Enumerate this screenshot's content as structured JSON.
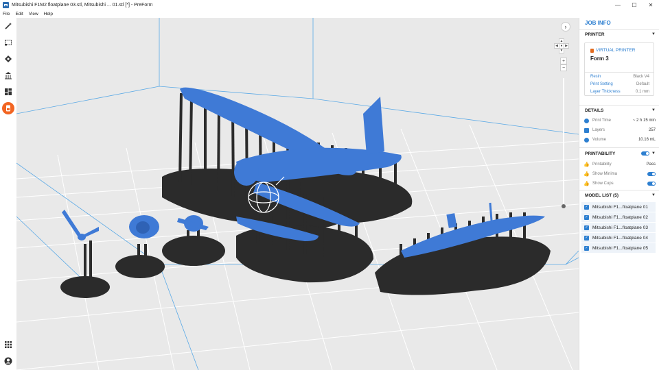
{
  "window": {
    "title": "Mitsubishi F1M2 floatplane 03.stl, Mitsubishi ... 01.stl [*] - PreForm",
    "controls": [
      "—",
      "☐",
      "✕"
    ]
  },
  "menu": [
    "File",
    "Edit",
    "View",
    "Help"
  ],
  "toolbar": {
    "tools": [
      "magic-wand-icon",
      "select-box-icon",
      "orient-icon",
      "supports-icon",
      "layout-icon",
      "print-icon"
    ],
    "active": "print-icon",
    "bottom": [
      "apps-grid-icon",
      "account-icon"
    ]
  },
  "viewport": {
    "nav_next": "›",
    "zoom_in": "+",
    "zoom_out": "−",
    "zoom_level": 0.05,
    "model_color": "#3f7ad6",
    "support_color": "#2b2b2b"
  },
  "panel": {
    "title": "JOB INFO",
    "printer": {
      "header": "PRINTER",
      "virtual_label": "VIRTUAL PRINTER",
      "name": "Form 3",
      "rows": [
        {
          "key": "Resin",
          "value": "Black V4"
        },
        {
          "key": "Print Setting",
          "value": "Default"
        },
        {
          "key": "Layer Thickness",
          "value": "0.1 mm"
        }
      ]
    },
    "details": {
      "header": "DETAILS",
      "rows": [
        {
          "key": "Print Time",
          "value": "~ 2 h 15 min"
        },
        {
          "key": "Layers",
          "value": "257"
        },
        {
          "key": "Volume",
          "value": "10.16 mL"
        }
      ]
    },
    "printability": {
      "header": "PRINTABILITY",
      "rows": [
        {
          "key": "Printability",
          "value": "Pass"
        },
        {
          "key": "Show Minima",
          "value": ""
        },
        {
          "key": "Show Cups",
          "value": ""
        }
      ]
    },
    "model_list": {
      "header": "MODEL LIST (5)",
      "items": [
        "Mitsubishi F1...floatplane 01",
        "Mitsubishi F1...floatplane 02",
        "Mitsubishi F1...floatplane 03",
        "Mitsubishi F1...floatplane 04",
        "Mitsubishi F1...floatplane 05"
      ]
    }
  }
}
